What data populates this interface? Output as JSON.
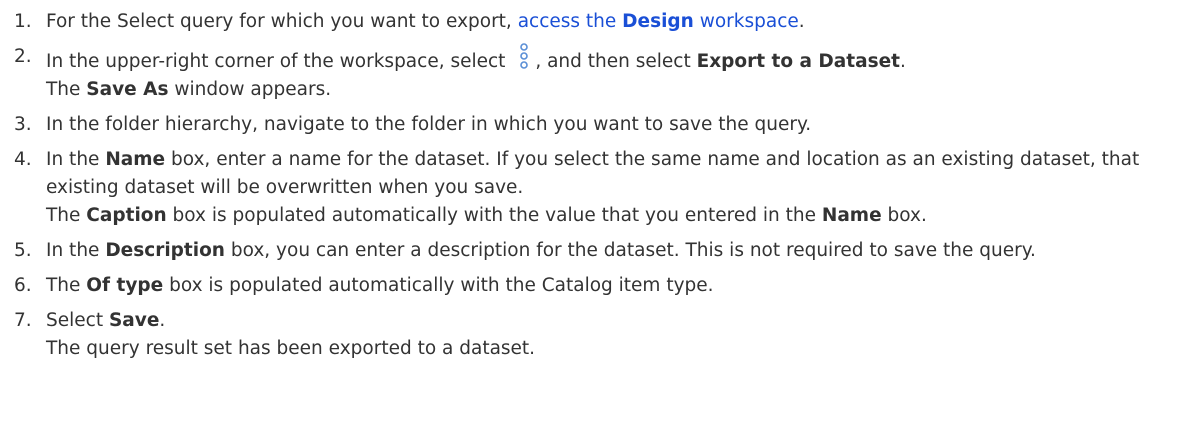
{
  "steps": [
    {
      "num": "1.",
      "text_a": "For the Select query for which you want to export, ",
      "link_a": "access the ",
      "link_b": "Design",
      "link_c": " workspace",
      "text_b": "."
    },
    {
      "num": "2.",
      "text_a": "In the upper-right corner of the workspace, select ",
      "icon": "more-options-vertical-icon",
      "text_b": ", and then select ",
      "bold_a": "Export to a Dataset",
      "text_c": ".",
      "result_a": "The ",
      "result_bold": "Save As",
      "result_b": " window appears."
    },
    {
      "num": "3.",
      "text_a": "In the folder hierarchy, navigate to the folder in which you want to save the query."
    },
    {
      "num": "4.",
      "text_a": "In the ",
      "bold_a": "Name",
      "text_b": " box, enter a name for the dataset. If you select the same name and location as an existing dataset, that existing dataset will be overwritten when you save.",
      "result_a": "The ",
      "result_bold_a": "Caption",
      "result_b": " box is populated automatically with the value that you entered in the ",
      "result_bold_b": "Name",
      "result_c": " box."
    },
    {
      "num": "5.",
      "text_a": "In the ",
      "bold_a": "Description",
      "text_b": " box, you can enter a description for the dataset. This is not required to save the query."
    },
    {
      "num": "6.",
      "text_a": "The ",
      "bold_a": "Of type",
      "text_b": " box is populated automatically with the Catalog item type."
    },
    {
      "num": "7.",
      "text_a": "Select ",
      "bold_a": "Save",
      "text_b": ".",
      "result_a": "The query result set has been exported to a dataset."
    }
  ],
  "colors": {
    "text": "#333333",
    "link": "#1a4fd6",
    "icon": "#5b8fd6"
  }
}
